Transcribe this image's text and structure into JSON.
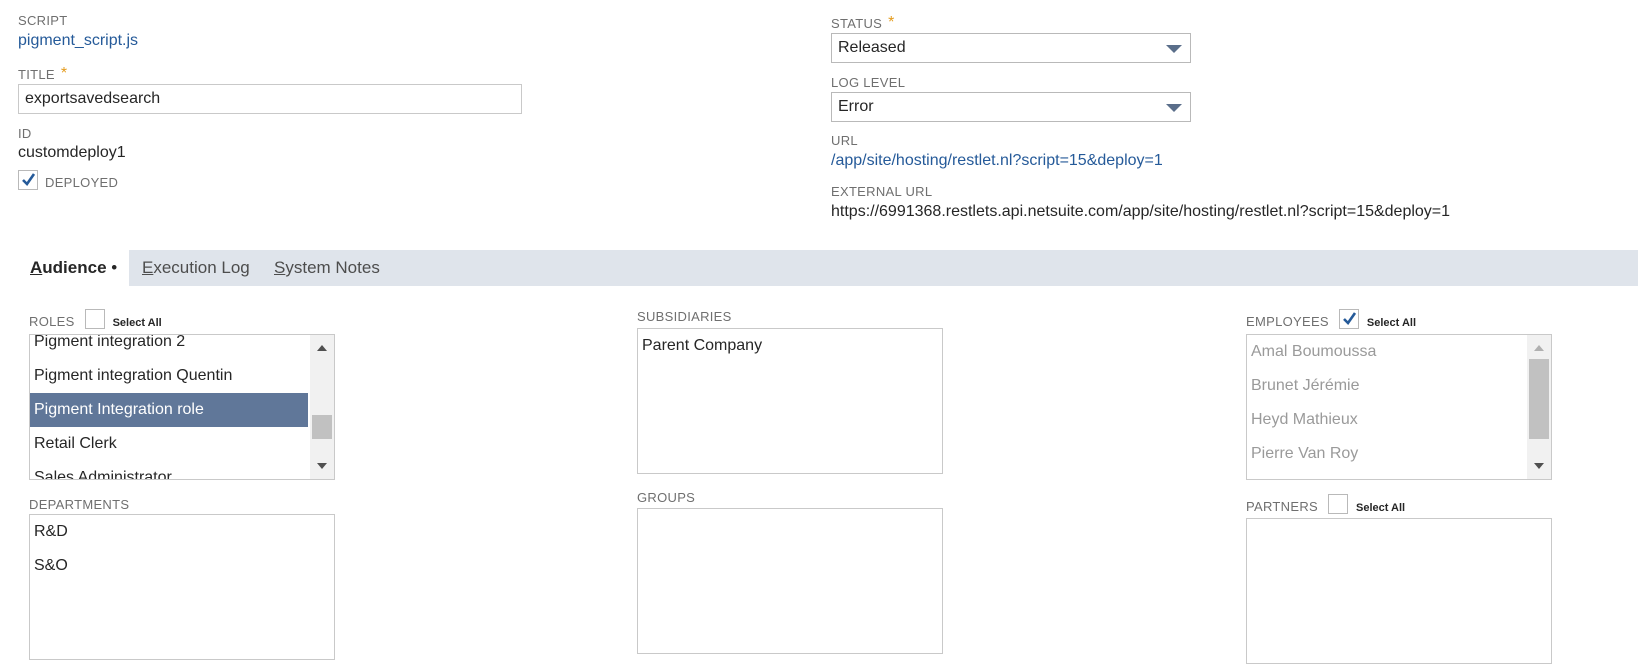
{
  "left_fields": {
    "script_label": "SCRIPT",
    "script_value": "pigment_script.js",
    "title_label": "TITLE",
    "title_value": "exportsavedsearch",
    "id_label": "ID",
    "id_value": "customdeploy1",
    "deployed_label": "DEPLOYED",
    "deployed_checked": true
  },
  "right_fields": {
    "status_label": "STATUS",
    "status_value": "Released",
    "log_level_label": "LOG LEVEL",
    "log_level_value": "Error",
    "url_label": "URL",
    "url_value": "/app/site/hosting/restlet.nl?script=15&deploy=1",
    "external_url_label": "EXTERNAL URL",
    "external_url_value": "https://6991368.restlets.api.netsuite.com/app/site/hosting/restlet.nl?script=15&deploy=1"
  },
  "required_mark": "*",
  "tabs": [
    {
      "accel": "A",
      "rest": "udience",
      "suffix": " •",
      "active": true
    },
    {
      "accel": "E",
      "rest": "xecution Log",
      "suffix": "",
      "active": false
    },
    {
      "accel": "S",
      "rest": "ystem Notes",
      "suffix": "",
      "active": false
    }
  ],
  "select_all_label": "Select All",
  "roles": {
    "label": "ROLES",
    "select_all_checked": false,
    "items": [
      "Pigment integration 2",
      "Pigment integration Quentin",
      "Pigment Integration role",
      "Retail Clerk",
      "Sales Administrator"
    ],
    "selected_index": 2
  },
  "departments": {
    "label": "DEPARTMENTS",
    "items": [
      "R&D",
      "S&O"
    ]
  },
  "subsidiaries": {
    "label": "SUBSIDIARIES",
    "items": [
      "Parent Company"
    ]
  },
  "groups": {
    "label": "GROUPS",
    "items": []
  },
  "employees": {
    "label": "EMPLOYEES",
    "select_all_checked": true,
    "items": [
      "Amal Boumoussa",
      "Brunet Jérémie",
      "Heyd Mathieux",
      "Pierre Van Roy"
    ]
  },
  "partners": {
    "label": "PARTNERS",
    "select_all_checked": false,
    "items": []
  },
  "colors": {
    "link": "#255a99",
    "required": "#e49b1c",
    "tab_bar": "#dfe4eb",
    "selected_row": "#607799",
    "check": "#255a99"
  }
}
